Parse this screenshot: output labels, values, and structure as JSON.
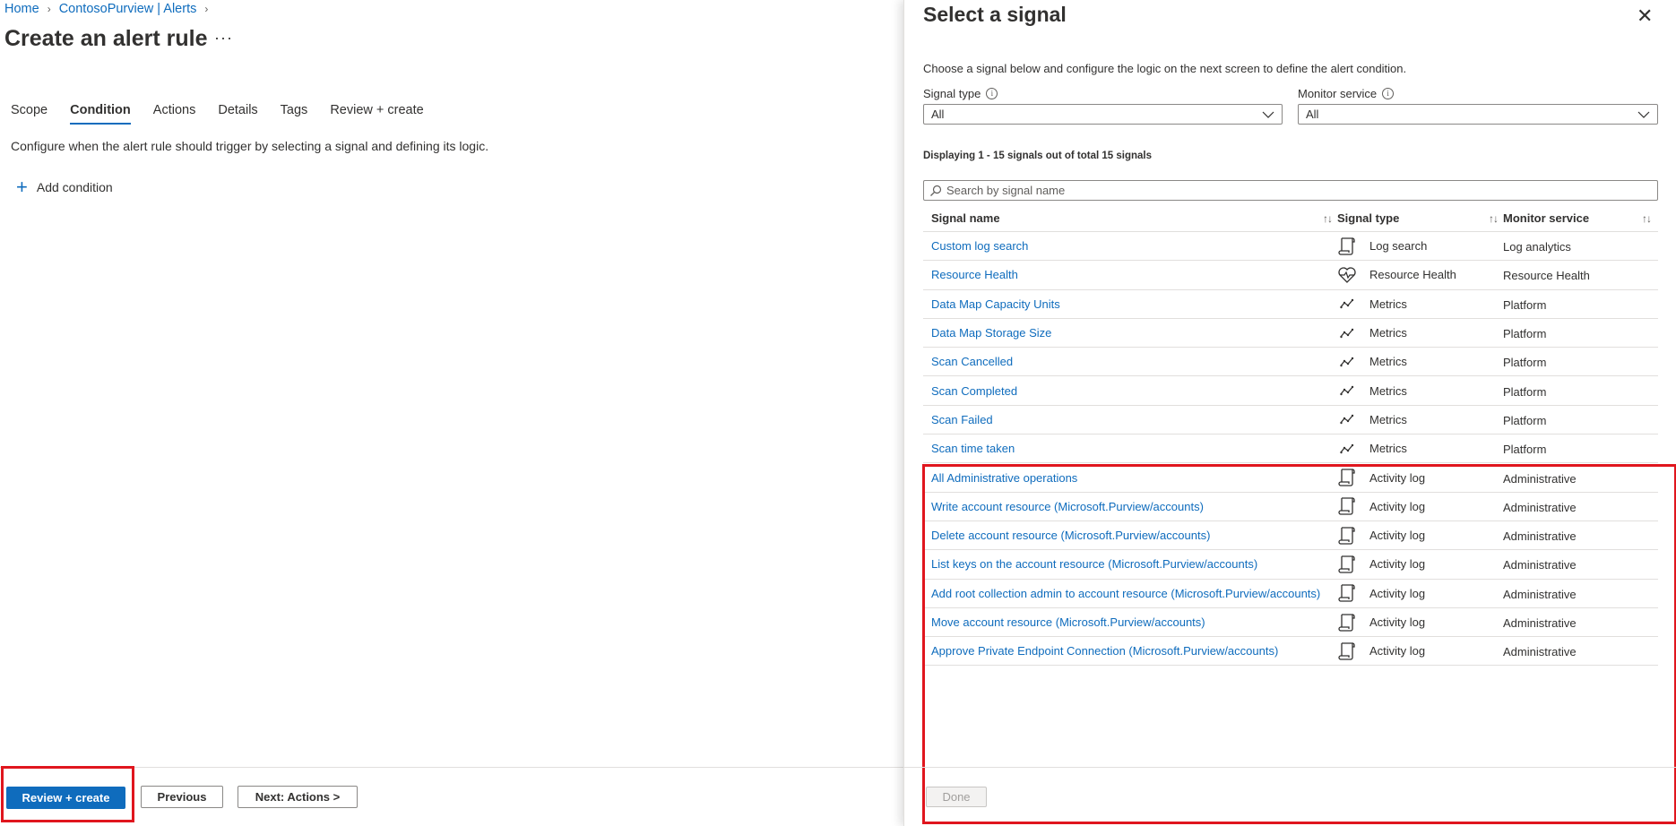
{
  "breadcrumb": [
    {
      "label": "Home"
    },
    {
      "label": "ContosoPurview | Alerts"
    }
  ],
  "page_title": "Create an alert rule",
  "more_label": "···",
  "tabs": [
    {
      "label": "Scope"
    },
    {
      "label": "Condition",
      "active": true
    },
    {
      "label": "Actions"
    },
    {
      "label": "Details"
    },
    {
      "label": "Tags"
    },
    {
      "label": "Review + create"
    }
  ],
  "description": "Configure when the alert rule should trigger by selecting a signal and defining its logic.",
  "add_condition_label": "Add condition",
  "footer": {
    "review_create": "Review + create",
    "previous": "Previous",
    "next": "Next: Actions >"
  },
  "panel": {
    "title": "Select a signal",
    "description": "Choose a signal below and configure the logic on the next screen to define the alert condition.",
    "signal_type_label": "Signal type",
    "signal_type_value": "All",
    "monitor_service_label": "Monitor service",
    "monitor_service_value": "All",
    "display_count": "Displaying 1 - 15 signals out of total 15 signals",
    "search_placeholder": "Search by signal name",
    "columns": [
      "Signal name",
      "Signal type",
      "Monitor service"
    ],
    "rows": [
      {
        "name": "Custom log search",
        "type": "Log search",
        "icon": "log-search-icon",
        "service": "Log analytics"
      },
      {
        "name": "Resource Health",
        "type": "Resource Health",
        "icon": "heart-pulse-icon",
        "service": "Resource Health"
      },
      {
        "name": "Data Map Capacity Units",
        "type": "Metrics",
        "icon": "metrics-icon",
        "service": "Platform"
      },
      {
        "name": "Data Map Storage Size",
        "type": "Metrics",
        "icon": "metrics-icon",
        "service": "Platform"
      },
      {
        "name": "Scan Cancelled",
        "type": "Metrics",
        "icon": "metrics-icon",
        "service": "Platform"
      },
      {
        "name": "Scan Completed",
        "type": "Metrics",
        "icon": "metrics-icon",
        "service": "Platform"
      },
      {
        "name": "Scan Failed",
        "type": "Metrics",
        "icon": "metrics-icon",
        "service": "Platform"
      },
      {
        "name": "Scan time taken",
        "type": "Metrics",
        "icon": "metrics-icon",
        "service": "Platform"
      },
      {
        "name": "All Administrative operations",
        "type": "Activity log",
        "icon": "activity-log-icon",
        "service": "Administrative"
      },
      {
        "name": "Write account resource (Microsoft.Purview/accounts)",
        "type": "Activity log",
        "icon": "activity-log-icon",
        "service": "Administrative"
      },
      {
        "name": "Delete account resource (Microsoft.Purview/accounts)",
        "type": "Activity log",
        "icon": "activity-log-icon",
        "service": "Administrative"
      },
      {
        "name": "List keys on the account resource (Microsoft.Purview/accounts)",
        "type": "Activity log",
        "icon": "activity-log-icon",
        "service": "Administrative"
      },
      {
        "name": "Add root collection admin to account resource (Microsoft.Purview/accounts)",
        "type": "Activity log",
        "icon": "activity-log-icon",
        "service": "Administrative"
      },
      {
        "name": "Move account resource (Microsoft.Purview/accounts)",
        "type": "Activity log",
        "icon": "activity-log-icon",
        "service": "Administrative"
      },
      {
        "name": "Approve Private Endpoint Connection (Microsoft.Purview/accounts)",
        "type": "Activity log",
        "icon": "activity-log-icon",
        "service": "Administrative"
      }
    ],
    "done_label": "Done"
  },
  "colors": {
    "accent": "#0f6cbd",
    "highlight": "#e0161e"
  }
}
